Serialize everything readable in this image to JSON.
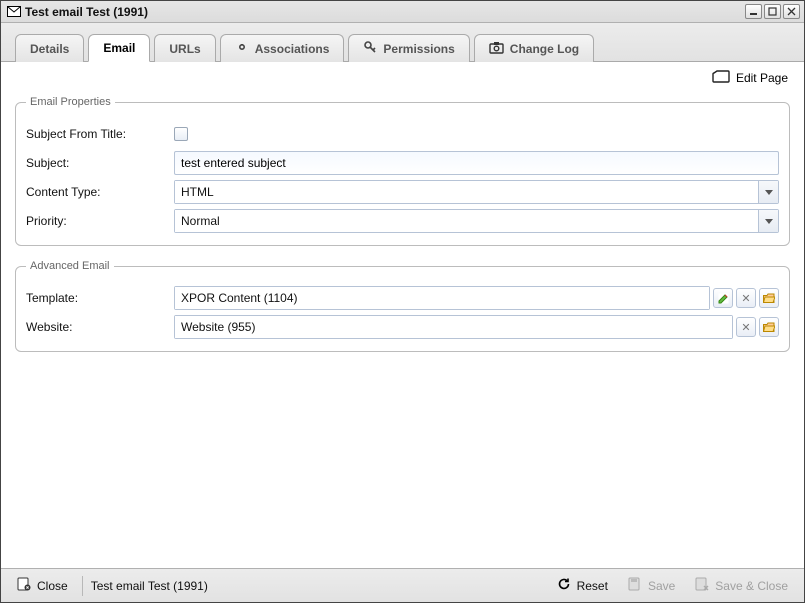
{
  "window": {
    "title": "Test email Test (1991)"
  },
  "tabs": [
    {
      "label": "Details"
    },
    {
      "label": "Email"
    },
    {
      "label": "URLs"
    },
    {
      "label": "Associations"
    },
    {
      "label": "Permissions"
    },
    {
      "label": "Change Log"
    }
  ],
  "actions": {
    "edit_page": "Edit Page"
  },
  "email_properties": {
    "legend": "Email Properties",
    "subject_from_title_label": "Subject From Title:",
    "subject_label": "Subject:",
    "subject_value": "test entered subject",
    "content_type_label": "Content Type:",
    "content_type_value": "HTML",
    "priority_label": "Priority:",
    "priority_value": "Normal"
  },
  "advanced_email": {
    "legend": "Advanced Email",
    "template_label": "Template:",
    "template_value": "XPOR Content (1104)",
    "website_label": "Website:",
    "website_value": "Website (955)"
  },
  "footer": {
    "close": "Close",
    "breadcrumb": "Test email Test (1991)",
    "reset": "Reset",
    "save": "Save",
    "save_close": "Save & Close"
  }
}
